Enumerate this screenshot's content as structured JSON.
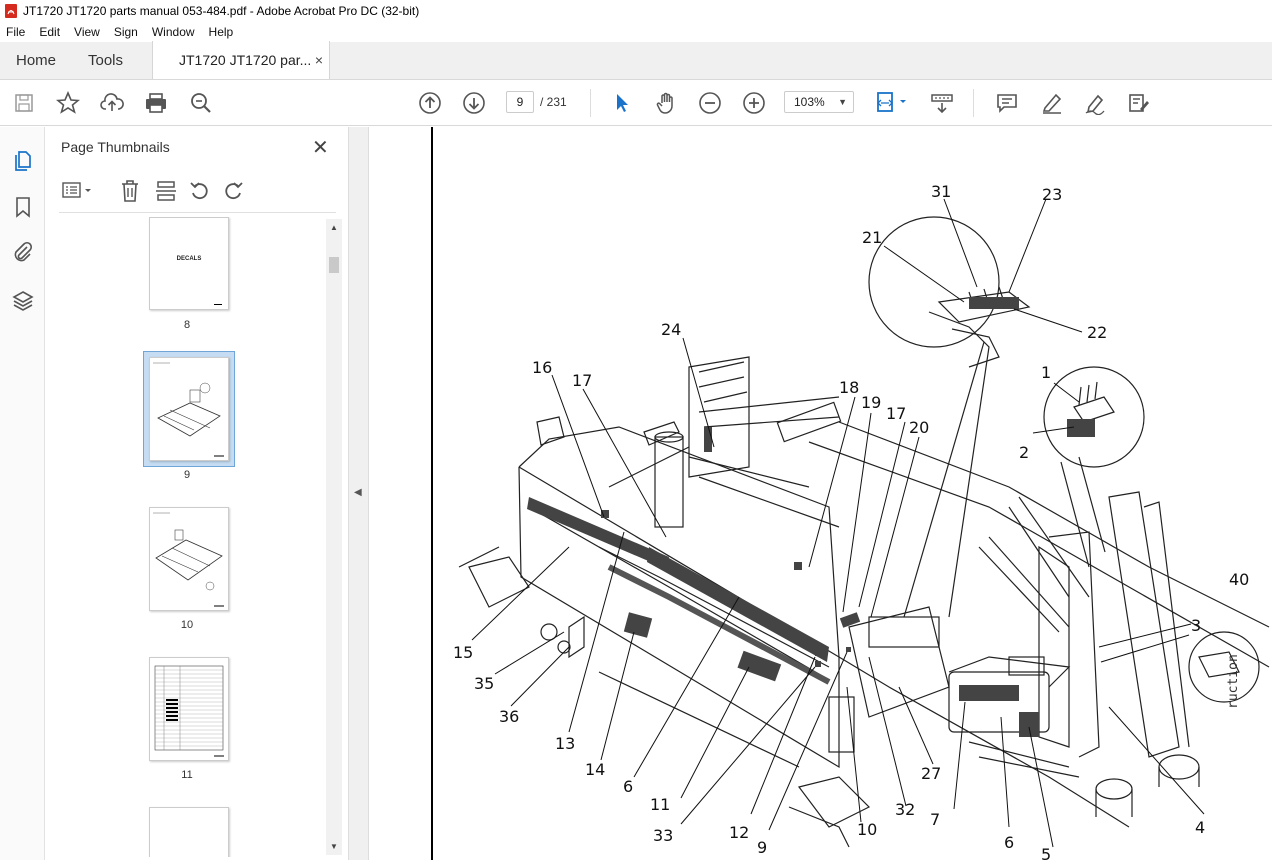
{
  "window": {
    "title": "JT1720 JT1720 parts manual 053-484.pdf - Adobe Acrobat Pro DC (32-bit)"
  },
  "menu": [
    "File",
    "Edit",
    "View",
    "Sign",
    "Window",
    "Help"
  ],
  "tabs": {
    "home": "Home",
    "tools": "Tools",
    "document": "JT1720 JT1720 par...",
    "close": "×"
  },
  "toolbar": {
    "page_current": "9",
    "page_total": "/ 231",
    "zoom": "103%"
  },
  "panel": {
    "title": "Page Thumbnails",
    "thumbnails": [
      {
        "label": "8",
        "text": "DECALS"
      },
      {
        "label": "9"
      },
      {
        "label": "10"
      },
      {
        "label": "11"
      }
    ]
  },
  "drawing": {
    "callouts": [
      "31",
      "23",
      "21",
      "22",
      "24",
      "1",
      "16",
      "17",
      "18",
      "19",
      "17",
      "20",
      "2",
      "3",
      "40",
      "15",
      "35",
      "36",
      "13",
      "14",
      "6",
      "11",
      "33",
      "12",
      "9",
      "10",
      "32",
      "27",
      "7",
      "6",
      "4",
      "5"
    ],
    "stamp": "ruction"
  },
  "colors": {
    "accent": "#1a73c9",
    "selection": "#c5dcf2",
    "acrobat_red": "#d42b1e"
  }
}
